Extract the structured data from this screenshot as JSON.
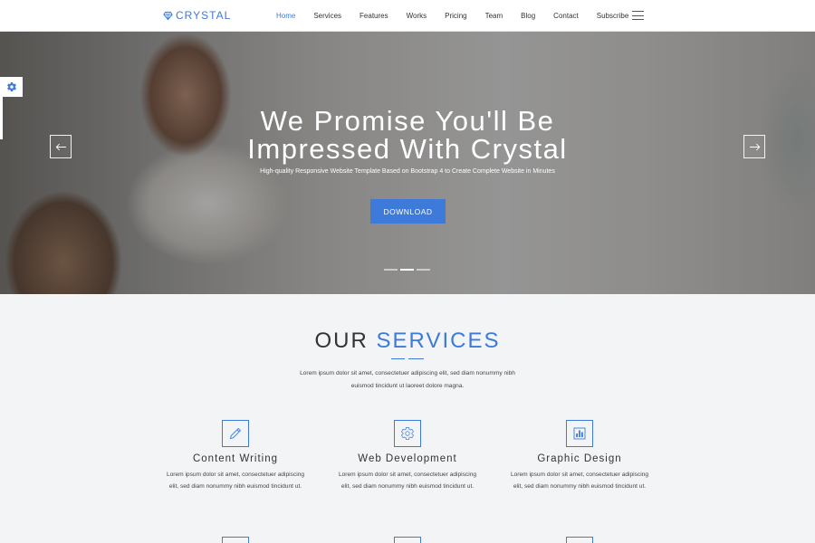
{
  "brand": {
    "name": "CRYSTAL",
    "icon": "diamond-icon"
  },
  "nav": {
    "items": [
      {
        "label": "Home",
        "active": true
      },
      {
        "label": "Services",
        "active": false
      },
      {
        "label": "Features",
        "active": false
      },
      {
        "label": "Works",
        "active": false
      },
      {
        "label": "Pricing",
        "active": false
      },
      {
        "label": "Team",
        "active": false
      },
      {
        "label": "Blog",
        "active": false
      },
      {
        "label": "Contact",
        "active": false
      },
      {
        "label": "Subscribe",
        "active": false
      }
    ],
    "menu_icon": "hamburger-icon"
  },
  "hero": {
    "title": "We Promise You'll Be Impressed With Crystal",
    "subtitle": "High-quality Responsive Website Template Based on Bootstrap 4 to Create Complete Website in Minutes",
    "button_label": "DOWNLOAD",
    "prev_icon": "arrow-left-icon",
    "next_icon": "arrow-right-icon",
    "slides_total": 3,
    "active_slide": 2
  },
  "settings": {
    "icon": "gear-icon"
  },
  "services": {
    "title_part1": "OUR",
    "title_part2": "SERVICES",
    "description": "Lorem ipsum dolor sit amet, consectetuer adipiscing elit, sed diam nonummy nibh euismod tincidunt ut laoreet dolore magna.",
    "items": [
      {
        "title": "Content Writing",
        "text": "Lorem ipsum dolor sit amet, consectetuer adipiscing elit, sed diam nonummy nibh euismod tincidunt ut.",
        "icon": "pencil-icon"
      },
      {
        "title": "Web Development",
        "text": "Lorem ipsum dolor sit amet, consectetuer adipiscing elit, sed diam nonummy nibh euismod tincidunt ut.",
        "icon": "gear-icon"
      },
      {
        "title": "Graphic Design",
        "text": "Lorem ipsum dolor sit amet, consectetuer adipiscing elit, sed diam nonummy nibh euismod tincidunt ut.",
        "icon": "bar-chart-icon"
      }
    ]
  },
  "colors": {
    "accent": "#3d7ad9",
    "nav_bg": "#ffffff",
    "page_bg": "#f3f4f6",
    "text": "#333333"
  }
}
